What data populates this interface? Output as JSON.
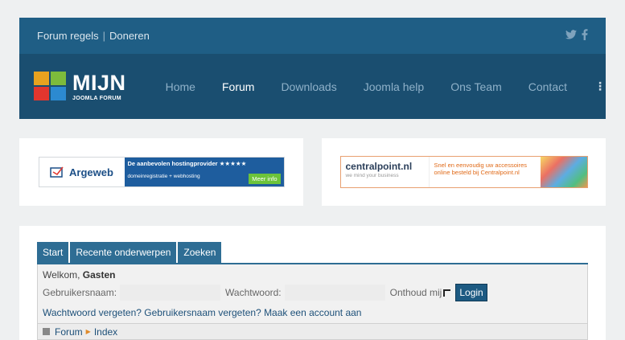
{
  "topbar": {
    "links": [
      "Forum regels",
      "Doneren"
    ],
    "separator": "|",
    "social_icons": [
      "twitter-icon",
      "facebook-icon"
    ]
  },
  "logo": {
    "title": "MIJN",
    "subtitle": "JOOMLA FORUM"
  },
  "nav": {
    "items": [
      {
        "label": "Home",
        "active": false
      },
      {
        "label": "Forum",
        "active": true
      },
      {
        "label": "Downloads",
        "active": false
      },
      {
        "label": "Joomla help",
        "active": false
      },
      {
        "label": "Ons Team",
        "active": false
      },
      {
        "label": "Contact",
        "active": false
      }
    ],
    "more_icon": "vertical-dots-icon",
    "more_glyph": "⋮"
  },
  "banners": {
    "argeweb": {
      "name": "Argeweb",
      "line1": "De aanbevolen hostingprovider ★★★★★",
      "line2": "domeinregistratie + webhosting",
      "button": "Meer info"
    },
    "centralpoint": {
      "name": "centralpoint.nl",
      "tagline": "we mind your business",
      "text": "Snel en eenvoudig uw accessoires online besteld bij Centralpoint.nl"
    }
  },
  "forum": {
    "tabs": [
      "Start",
      "Recente onderwerpen",
      "Zoeken"
    ],
    "welcome_prefix": "Welkom,",
    "welcome_user": "Gasten",
    "username_label": "Gebruikersnaam:",
    "password_label": "Wachtwoord:",
    "remember_label": "Onthoud mij",
    "login_button": "Login",
    "links": [
      "Wachtwoord vergeten?",
      "Gebruikersnaam vergeten?",
      "Maak een account aan"
    ],
    "breadcrumb": [
      "Forum",
      "Index"
    ]
  },
  "colors": {
    "header_top": "#1f5e85",
    "header_main": "#1a4e70",
    "tab": "#2e6d94",
    "link": "#1d5079",
    "page_bg": "#eef0f1"
  }
}
